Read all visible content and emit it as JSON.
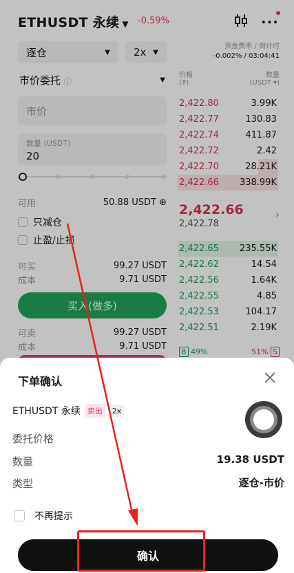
{
  "header": {
    "symbol": "ETHUSDT 永续",
    "change": "-0.59%"
  },
  "form": {
    "margin_mode": "逐仓",
    "leverage": "2x",
    "order_type": "市价委托",
    "price_placeholder": "市价",
    "qty_label": "数量 (USDT)",
    "qty_value": "20",
    "available_label": "可用",
    "available_value": "50.88 USDT",
    "reduce_only": "只减仓",
    "tp_sl": "止盈/止损",
    "buy_max_label": "可买",
    "buy_max_value": "99.27 USDT",
    "cost_label": "成本",
    "cost_value": "9.71 USDT",
    "buy_button": "买入(做多)",
    "sell_max_label": "可卖",
    "sell_max_value": "99.27 USDT",
    "cost2_label": "成本",
    "cost2_value": "9.71 USDT"
  },
  "funding": {
    "label": "资金费率 / 倒计时",
    "value": "-0.002% / 03:04:41"
  },
  "orderbook": {
    "price_header": "价格",
    "price_unit": "(₮)",
    "qty_header": "数量",
    "qty_unit": "(USDT ▾)",
    "asks": [
      {
        "price": "2,422.80",
        "qty": "3.99K"
      },
      {
        "price": "2,422.77",
        "qty": "130.83"
      },
      {
        "price": "2,422.74",
        "qty": "411.87"
      },
      {
        "price": "2,422.72",
        "qty": "2.42"
      },
      {
        "price": "2,422.70",
        "qty": "28.21K"
      },
      {
        "price": "2,422.66",
        "qty": "338.99K"
      }
    ],
    "last_price": "2,422.66",
    "mark_price": "2,422.78",
    "bids": [
      {
        "price": "2,422.65",
        "qty": "235.55K"
      },
      {
        "price": "2,422.62",
        "qty": "14.54"
      },
      {
        "price": "2,422.56",
        "qty": "1.64K"
      },
      {
        "price": "2,422.55",
        "qty": "4.85"
      },
      {
        "price": "2,422.53",
        "qty": "104.17"
      },
      {
        "price": "2,422.51",
        "qty": "2.19K"
      }
    ],
    "buy_tag": "B",
    "buy_pct": "49%",
    "sell_pct": "51%",
    "sell_tag": "S"
  },
  "modal": {
    "title": "下单确认",
    "symbol": "ETHUSDT 永续",
    "side_badge": "卖出",
    "leverage_badge": "2x",
    "price_label": "委托价格",
    "qty_label": "数量",
    "qty_value": "19.38 USDT",
    "type_label": "类型",
    "type_value": "逐仓-市价",
    "no_remind": "不再提示",
    "confirm": "确认"
  },
  "colors": {
    "ask": "#d8324f",
    "bid": "#1e9c52",
    "buy_button": "#22a35a",
    "annotation": "#e8211b"
  }
}
